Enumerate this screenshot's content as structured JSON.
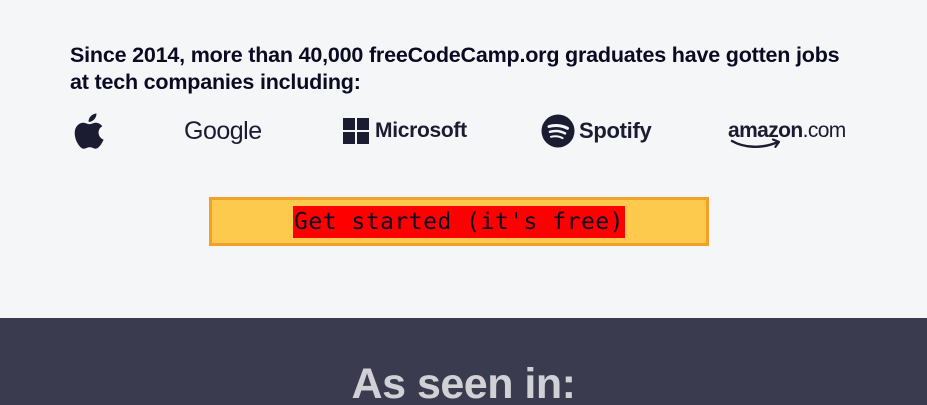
{
  "hero": {
    "intro_text": "Since 2014, more than 40,000 freeCodeCamp.org graduates have gotten jobs at tech companies including:"
  },
  "companies": {
    "apple_icon": "apple-logo",
    "google": "Google",
    "microsoft": "Microsoft",
    "spotify": "Spotify",
    "amazon_main": "amazon",
    "amazon_suffix": ".com"
  },
  "cta": {
    "label": "Get started (it's free)"
  },
  "press": {
    "title": "As seen in:"
  },
  "colors": {
    "background": "#f5f6f7",
    "dark_section": "#3b3b4f",
    "button_bg": "#feca4e",
    "button_border": "#f1a02a",
    "button_label_highlight": "#ff0000",
    "text_dark": "#0a0a23"
  }
}
